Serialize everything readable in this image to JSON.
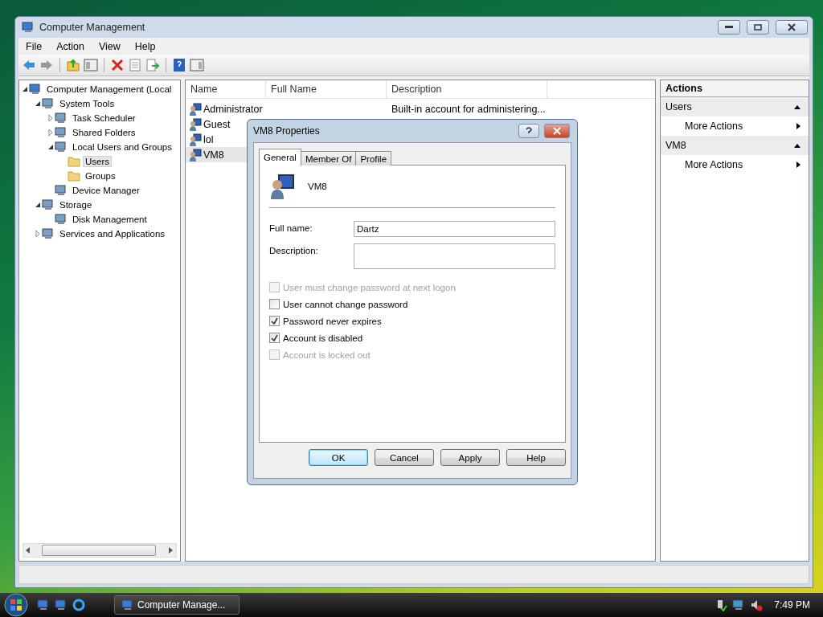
{
  "window": {
    "title": "Computer Management"
  },
  "menu": [
    "File",
    "Action",
    "View",
    "Help"
  ],
  "tree": [
    {
      "label": "Computer Management (Local",
      "expanded": true,
      "selected": false,
      "children": [
        {
          "label": "System Tools",
          "expanded": true,
          "selected": false,
          "children": [
            {
              "label": "Task Scheduler",
              "expanded": false,
              "selected": false
            },
            {
              "label": "Shared Folders",
              "expanded": false,
              "selected": false
            },
            {
              "label": "Local Users and Groups",
              "expanded": true,
              "selected": false,
              "children": [
                {
                  "label": "Users",
                  "selected": true
                },
                {
                  "label": "Groups",
                  "selected": false
                }
              ]
            },
            {
              "label": "Device Manager",
              "selected": false
            }
          ]
        },
        {
          "label": "Storage",
          "expanded": true,
          "selected": false,
          "children": [
            {
              "label": "Disk Management",
              "selected": false
            }
          ]
        },
        {
          "label": "Services and Applications",
          "expanded": false,
          "selected": false
        }
      ]
    }
  ],
  "list": {
    "columns": [
      "Name",
      "Full Name",
      "Description"
    ],
    "rows": [
      {
        "name": "Administrator",
        "description": "Built-in account for administering...",
        "selected": false
      },
      {
        "name": "Guest",
        "selected": false
      },
      {
        "name": "lol",
        "selected": false
      },
      {
        "name": "VM8",
        "selected": true
      }
    ]
  },
  "actions": {
    "title": "Actions",
    "sections": [
      {
        "title": "Users",
        "expanded": true,
        "items": [
          "More Actions"
        ]
      },
      {
        "title": "VM8",
        "expanded": true,
        "items": [
          "More Actions"
        ]
      }
    ]
  },
  "dialog": {
    "title": "VM8 Properties",
    "tabs": [
      {
        "label": "General",
        "selected": true
      },
      {
        "label": "Member Of",
        "selected": false
      },
      {
        "label": "Profile",
        "selected": false
      }
    ],
    "user_name": "VM8",
    "fields": [
      {
        "label": "Full name:",
        "value": "Dartz",
        "kind": "line"
      },
      {
        "label": "Description:",
        "kind": "box"
      }
    ],
    "checkboxes": [
      {
        "label": "User must change password at next logon",
        "checked": false,
        "disabled": true
      },
      {
        "label": "User cannot change password",
        "checked": false,
        "disabled": false
      },
      {
        "label": "Password never expires",
        "checked": true,
        "disabled": false
      },
      {
        "label": "Account is disabled",
        "checked": true,
        "disabled": false
      },
      {
        "label": "Account is locked out",
        "checked": false,
        "disabled": true
      }
    ],
    "buttons": [
      {
        "label": "OK",
        "default": true
      },
      {
        "label": "Cancel",
        "default": false
      },
      {
        "label": "Apply",
        "default": false
      },
      {
        "label": "Help",
        "default": false
      }
    ]
  },
  "taskbar": {
    "task": "Computer Manage...",
    "clock": "7:49 PM"
  }
}
